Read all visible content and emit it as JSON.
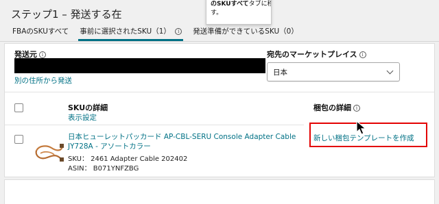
{
  "header": {
    "step_title": "ステップ1 – 発送する在"
  },
  "tooltip": {
    "line1": "のSKUすべて",
    "line1_rest": "タブに移動しま",
    "line2": "す。"
  },
  "tabs": [
    {
      "label": "FBAのSKUすべて"
    },
    {
      "label": "事前に選択されたSKU（1）"
    },
    {
      "label": "発送準備ができているSKU（0）"
    }
  ],
  "shipping": {
    "origin_label": "発送元",
    "other_address_link": "別の住所から発送",
    "destination_label": "宛先のマーケットプレイス",
    "destination_value": "日本"
  },
  "table": {
    "sku_details_header": "SKUの詳細",
    "display_settings_link": "表示設定",
    "pack_details_header": "梱包の詳細"
  },
  "product": {
    "name_line1": "日本ヒューレットパッカード AP-CBL-SERU Console Adapter Cable",
    "name_line2": "JY728A - アソートカラー",
    "sku_line": "SKU：  2461 Adapter Cable 202402",
    "asin_line": "ASIN：  B071YNFZBG",
    "new_template_link": "新しい梱包テンプレートを作成"
  },
  "icons": {
    "info": "info-circle-icon",
    "chevron": "chevron-down-icon",
    "cursor": "mouse-pointer-icon"
  },
  "colors": {
    "link": "#007185",
    "highlight": "#e30000",
    "redaction": "#000000"
  }
}
